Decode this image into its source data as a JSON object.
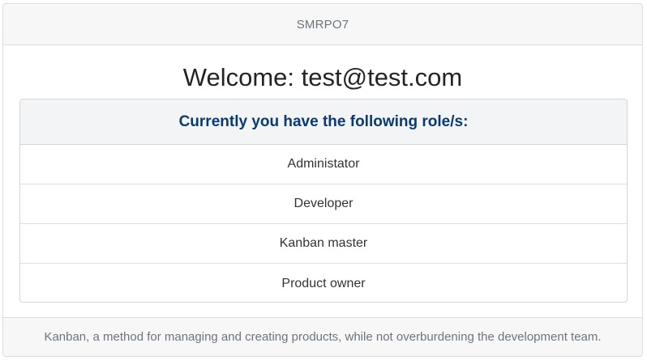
{
  "header": {
    "title": "SMRPO7"
  },
  "main": {
    "welcome_label": "Welcome:",
    "user_email": "test@test.com",
    "roles_title": "Currently you have the following role/s:",
    "roles": [
      "Administator",
      "Developer",
      "Kanban master",
      "Product owner"
    ]
  },
  "footer": {
    "text": "Kanban, a method for managing and creating products, while not overburdening the development team."
  },
  "colors": {
    "roles_title": "#0b3a73",
    "header_bg": "#f7f7f7",
    "muted_text": "#6c757d"
  }
}
